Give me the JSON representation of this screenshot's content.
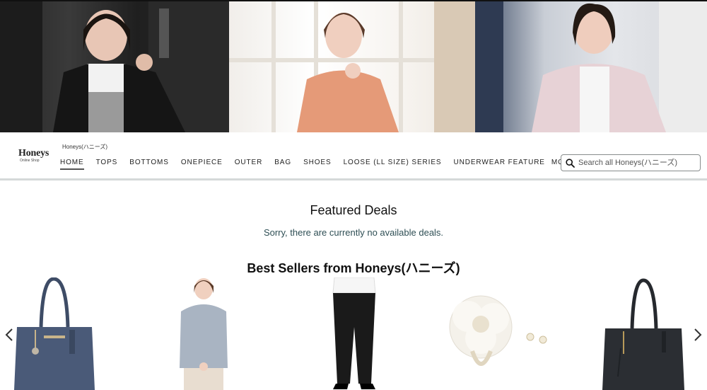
{
  "hero": {
    "panels": [
      "model-black-coat",
      "model-orange-knit",
      "model-pink-fleece"
    ]
  },
  "store": {
    "logo_main": "Honeys",
    "logo_sub": "Online Shop",
    "breadcrumb": "Honeys(ハニーズ)",
    "nav": [
      {
        "label": "HOME",
        "active": true
      },
      {
        "label": "TOPS"
      },
      {
        "label": "BOTTOMS"
      },
      {
        "label": "ONEPIECE"
      },
      {
        "label": "OUTER"
      },
      {
        "label": "BAG"
      },
      {
        "label": "SHOES"
      },
      {
        "label": "LOOSE (LL SIZE) SERIES"
      },
      {
        "label": "UNDERWEAR FEATURE"
      }
    ],
    "more_label": "MORE",
    "search_placeholder": "Search all Honeys(ハニーズ)"
  },
  "featured": {
    "title": "Featured Deals",
    "message": "Sorry, there are currently no available deals."
  },
  "best_sellers": {
    "title": "Best Sellers from Honeys(ハニーズ)",
    "products": [
      {
        "name": "navy-tote-bag",
        "color": "#4a5a78"
      },
      {
        "name": "gray-knit-sweater",
        "color": "#a9b4c2"
      },
      {
        "name": "black-slim-pants",
        "color": "#1a1a1a"
      },
      {
        "name": "white-flower-corsage",
        "color": "#f4f1ea"
      },
      {
        "name": "black-tote-bag",
        "color": "#2b2e33"
      }
    ]
  },
  "colors": {
    "border": "#d5d9d9",
    "text_muted": "#2f4f55",
    "active_underline": "#555555"
  }
}
